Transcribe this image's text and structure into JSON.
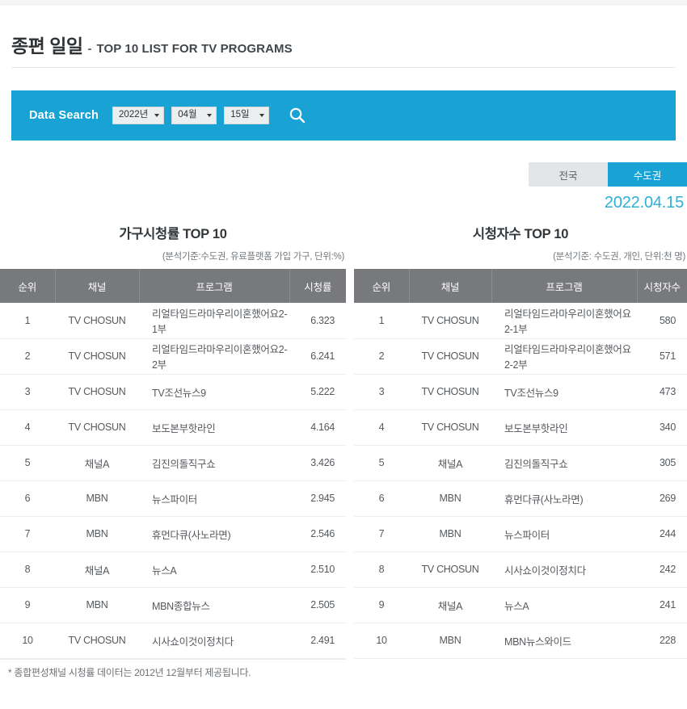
{
  "header": {
    "title_ko": "종편 일일",
    "title_dash": "-",
    "title_en": "TOP 10 LIST FOR TV PROGRAMS"
  },
  "search": {
    "label": "Data Search",
    "year": "2022년",
    "month": "04월",
    "day": "15일",
    "search_icon": "search-icon",
    "bar_color": "#19a3d5"
  },
  "region_tabs": {
    "nationwide": "전국",
    "metropolitan": "수도권",
    "active": "수도권",
    "active_color": "#19a3d5",
    "inactive_color": "#e3e5e7"
  },
  "date_stamp": "2022.04.15",
  "tables": {
    "left": {
      "title": "가구시청률 TOP 10",
      "subtitle": "(분석기준:수도권, 유료플랫폼 가입 가구, 단위:%)",
      "columns": [
        "순위",
        "채널",
        "프로그램",
        "시청률"
      ],
      "rows": [
        {
          "rank": "1",
          "channel": "TV CHOSUN",
          "program": "리얼타임드라마우리이혼했어요2-1부",
          "value": "6.323"
        },
        {
          "rank": "2",
          "channel": "TV CHOSUN",
          "program": "리얼타임드라마우리이혼했어요2-2부",
          "value": "6.241"
        },
        {
          "rank": "3",
          "channel": "TV CHOSUN",
          "program": "TV조선뉴스9",
          "value": "5.222"
        },
        {
          "rank": "4",
          "channel": "TV CHOSUN",
          "program": "보도본부핫라인",
          "value": "4.164"
        },
        {
          "rank": "5",
          "channel": "채널A",
          "program": "김진의돌직구쇼",
          "value": "3.426"
        },
        {
          "rank": "6",
          "channel": "MBN",
          "program": "뉴스파이터",
          "value": "2.945"
        },
        {
          "rank": "7",
          "channel": "MBN",
          "program": "휴먼다큐(사노라면)",
          "value": "2.546"
        },
        {
          "rank": "8",
          "channel": "채널A",
          "program": "뉴스A",
          "value": "2.510"
        },
        {
          "rank": "9",
          "channel": "MBN",
          "program": "MBN종합뉴스",
          "value": "2.505"
        },
        {
          "rank": "10",
          "channel": "TV CHOSUN",
          "program": "시사쇼이것이정치다",
          "value": "2.491"
        }
      ]
    },
    "right": {
      "title": "시청자수 TOP 10",
      "subtitle": "(분석기준: 수도권, 개인, 단위:천 명)",
      "columns": [
        "순위",
        "채널",
        "프로그램",
        "시청자수"
      ],
      "rows": [
        {
          "rank": "1",
          "channel": "TV CHOSUN",
          "program": "리얼타임드라마우리이혼했어요2-1부",
          "value": "580"
        },
        {
          "rank": "2",
          "channel": "TV CHOSUN",
          "program": "리얼타임드라마우리이혼했어요2-2부",
          "value": "571"
        },
        {
          "rank": "3",
          "channel": "TV CHOSUN",
          "program": "TV조선뉴스9",
          "value": "473"
        },
        {
          "rank": "4",
          "channel": "TV CHOSUN",
          "program": "보도본부핫라인",
          "value": "340"
        },
        {
          "rank": "5",
          "channel": "채널A",
          "program": "김진의돌직구쇼",
          "value": "305"
        },
        {
          "rank": "6",
          "channel": "MBN",
          "program": "휴먼다큐(사노라면)",
          "value": "269"
        },
        {
          "rank": "7",
          "channel": "MBN",
          "program": "뉴스파이터",
          "value": "244"
        },
        {
          "rank": "8",
          "channel": "TV CHOSUN",
          "program": "시사쇼이것이정치다",
          "value": "242"
        },
        {
          "rank": "9",
          "channel": "채널A",
          "program": "뉴스A",
          "value": "241"
        },
        {
          "rank": "10",
          "channel": "MBN",
          "program": "MBN뉴스와이드",
          "value": "228"
        }
      ]
    }
  },
  "footnote": "* 종합편성채널 시청률 데이터는 2012년 12월부터 제공됩니다.",
  "colors": {
    "accent_blue": "#19a3d5",
    "value_teal": "#36a5c6",
    "header_gray": "#78797c",
    "date_blue": "#2cb0d8"
  }
}
